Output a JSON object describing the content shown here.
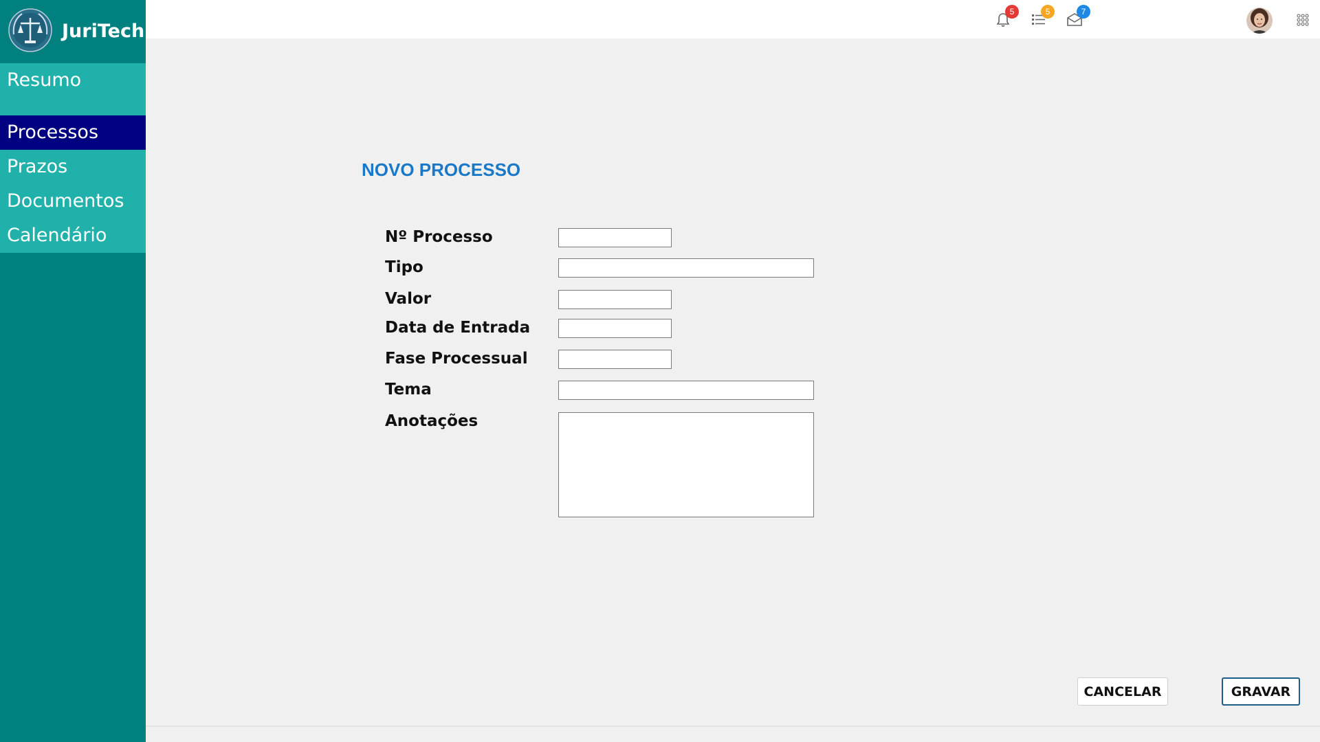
{
  "brand": {
    "name": "JuriTech",
    "logo_icon": "scales-of-justice-icon"
  },
  "sidebar": {
    "items": [
      {
        "label": "Resumo",
        "active": false
      },
      {
        "label": "Processos",
        "active": true
      },
      {
        "label": "Prazos",
        "active": false
      },
      {
        "label": "Documentos",
        "active": false
      },
      {
        "label": "Calendário",
        "active": false
      }
    ]
  },
  "topbar": {
    "notifications_badge": "5",
    "tasks_badge": "5",
    "messages_badge": "7"
  },
  "form": {
    "title": "NOVO PROCESSO",
    "fields": [
      {
        "label": "Nº Processo",
        "value": ""
      },
      {
        "label": "Tipo",
        "value": ""
      },
      {
        "label": "Valor",
        "value": ""
      },
      {
        "label": "Data de Entrada",
        "value": ""
      },
      {
        "label": "Fase Processual",
        "value": ""
      },
      {
        "label": "Tema",
        "value": ""
      },
      {
        "label": "Anotações",
        "value": ""
      }
    ]
  },
  "actions": {
    "cancel_label": "CANCELAR",
    "save_label": "GRAVAR"
  },
  "colors": {
    "sidebar_bg": "#00807f",
    "nav_item_bg": "#20b2aa",
    "nav_active_bg": "#000080",
    "title_color": "#1a78c8",
    "badge_red": "#e53935",
    "badge_orange": "#f5a623",
    "badge_blue": "#1e88e5"
  }
}
